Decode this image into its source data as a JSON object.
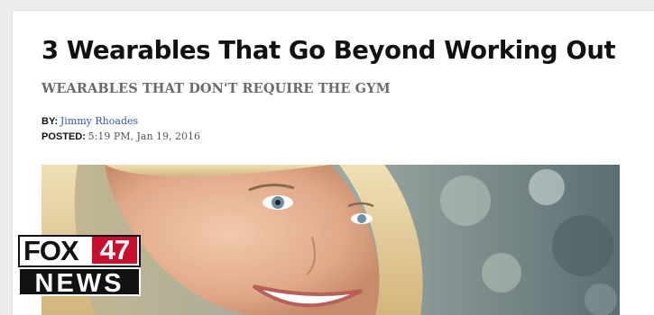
{
  "article": {
    "headline": "3 Wearables That Go Beyond Working Out",
    "subheadline": "WEARABLES THAT DON'T REQUIRE THE GYM",
    "byline_label": "BY:",
    "author": "Jimmy Rhoades",
    "posted_label": "POSTED:",
    "posted_date": "5:19 PM, Jan 19, 2016"
  },
  "logo": {
    "station_word": "FOX",
    "channel_number": "47",
    "news_word": "NEWS",
    "brand_red": "#c8102e"
  },
  "colors": {
    "author_link": "#3558b5",
    "subheadline": "#6b6b6b",
    "background": "#ececec"
  }
}
